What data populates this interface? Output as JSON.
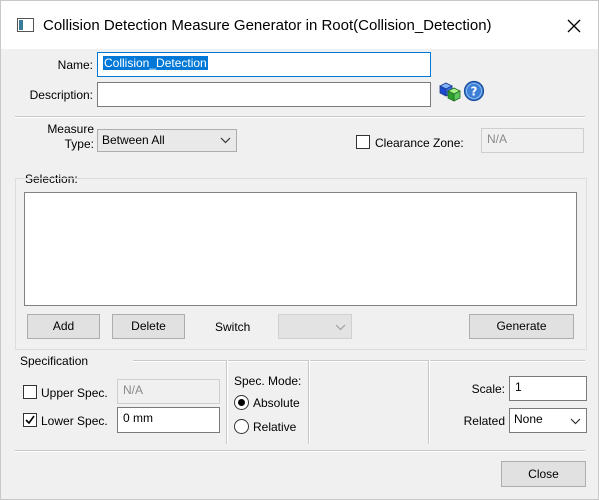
{
  "window": {
    "title": "Collision Detection Measure Generator in Root(Collision_Detection)"
  },
  "form": {
    "name_label": "Name:",
    "name_value": "Collision_Detection",
    "description_label": "Description:",
    "description_value": "",
    "measure_type_label_line1": "Measure",
    "measure_type_label_line2": "Type:",
    "measure_type_value": "Between All",
    "clearance_zone_label": "Clearance Zone:",
    "clearance_zone_checked": false,
    "clearance_zone_value": "N/A"
  },
  "selection": {
    "label": "Selection:",
    "items": [],
    "add_label": "Add",
    "delete_label": "Delete",
    "switch_label": "Switch",
    "switch_value": "",
    "generate_label": "Generate"
  },
  "specification": {
    "label": "Specification",
    "upper_label": "Upper Spec.",
    "upper_checked": false,
    "upper_value": "N/A",
    "lower_label": "Lower Spec.",
    "lower_checked": true,
    "lower_value": "0 mm",
    "spec_mode_label": "Spec. Mode:",
    "mode_absolute_label": "Absolute",
    "mode_relative_label": "Relative",
    "mode_selected": "Absolute",
    "scale_label": "Scale:",
    "scale_value": "1",
    "related_label": "Related",
    "related_value": "None"
  },
  "footer": {
    "close_label": "Close"
  },
  "icons": {
    "app": "window-app-icon",
    "close": "close-icon",
    "cubes": "cubes-icon",
    "help": "help-icon",
    "dropdown": "chevron-down-icon",
    "check": "check-icon"
  }
}
